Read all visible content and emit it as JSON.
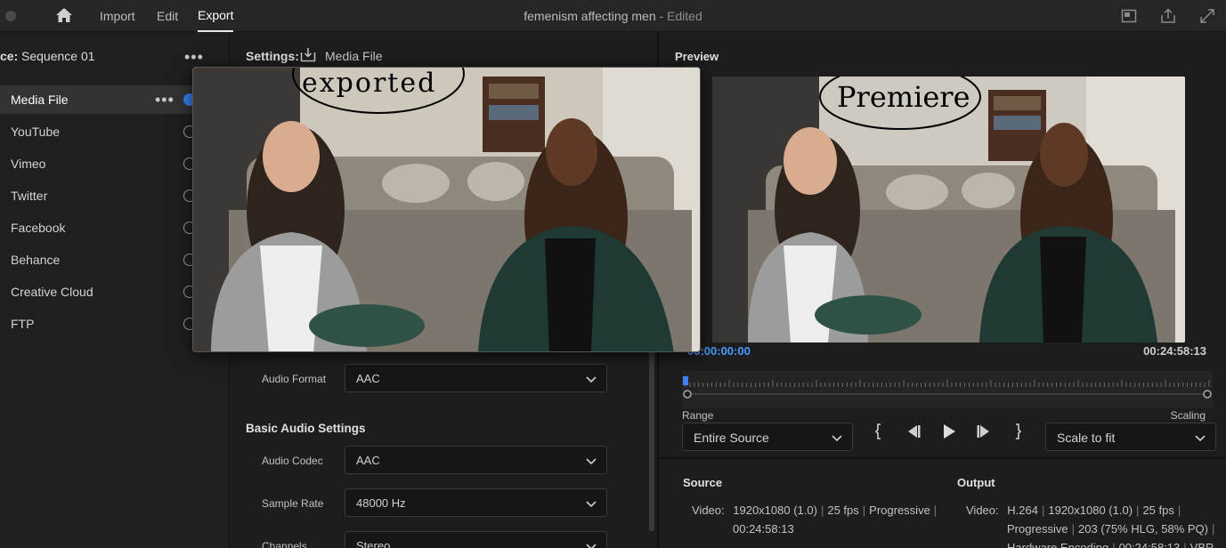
{
  "topbar": {
    "nav": [
      {
        "label": "Import"
      },
      {
        "label": "Edit"
      },
      {
        "label": "Export"
      }
    ],
    "title": "femenism affecting men",
    "title_status": " - Edited",
    "icons": [
      "home-icon",
      "quick-export-icon",
      "share-icon",
      "fullscreen-icon"
    ]
  },
  "left": {
    "source_label": "ce:",
    "source_value": "Sequence 01",
    "destinations": [
      {
        "label": "Media File",
        "selected": true
      },
      {
        "label": "YouTube"
      },
      {
        "label": "Vimeo"
      },
      {
        "label": "Twitter"
      },
      {
        "label": "Facebook"
      },
      {
        "label": "Behance"
      },
      {
        "label": "Creative Cloud"
      },
      {
        "label": "FTP"
      }
    ]
  },
  "settings": {
    "label": "Settings:",
    "target": "Media File",
    "audio_format_label": "Audio Format",
    "audio_format_value": "AAC",
    "basic_audio_heading": "Basic Audio Settings",
    "audio_codec_label": "Audio Codec",
    "audio_codec_value": "AAC",
    "sample_rate_label": "Sample Rate",
    "sample_rate_value": "48000 Hz",
    "channels_label": "Channels",
    "channels_value": "Stereo"
  },
  "preview": {
    "label": "Preview",
    "timecode_start": "00:00:00:00",
    "timecode_end": "00:24:58:13",
    "range_label": "Range",
    "range_value": "Entire Source",
    "scaling_label": "Scaling",
    "scaling_value": "Scale to fit",
    "annotation": "Premiere"
  },
  "exported_overlay": {
    "annotation": "exported"
  },
  "source_info": {
    "heading": "Source",
    "video_label": "Video:",
    "resolution": "1920x1080 (1.0)",
    "fps": "25 fps",
    "scan": "Progressive",
    "duration": "00:24:58:13"
  },
  "output_info": {
    "heading": "Output",
    "video_label": "Video:",
    "codec": "H.264",
    "resolution": "1920x1080 (1.0)",
    "fps": "25 fps",
    "scan": "Progressive",
    "color": "203 (75% HLG, 58% PQ)",
    "encoding": "Hardware Encoding",
    "duration": "00:24:58:13",
    "bitrate_mode": "VBR"
  },
  "colors": {
    "accent": "#3b82f6",
    "timecode": "#4a9cff",
    "panel": "#1d1d1d"
  }
}
